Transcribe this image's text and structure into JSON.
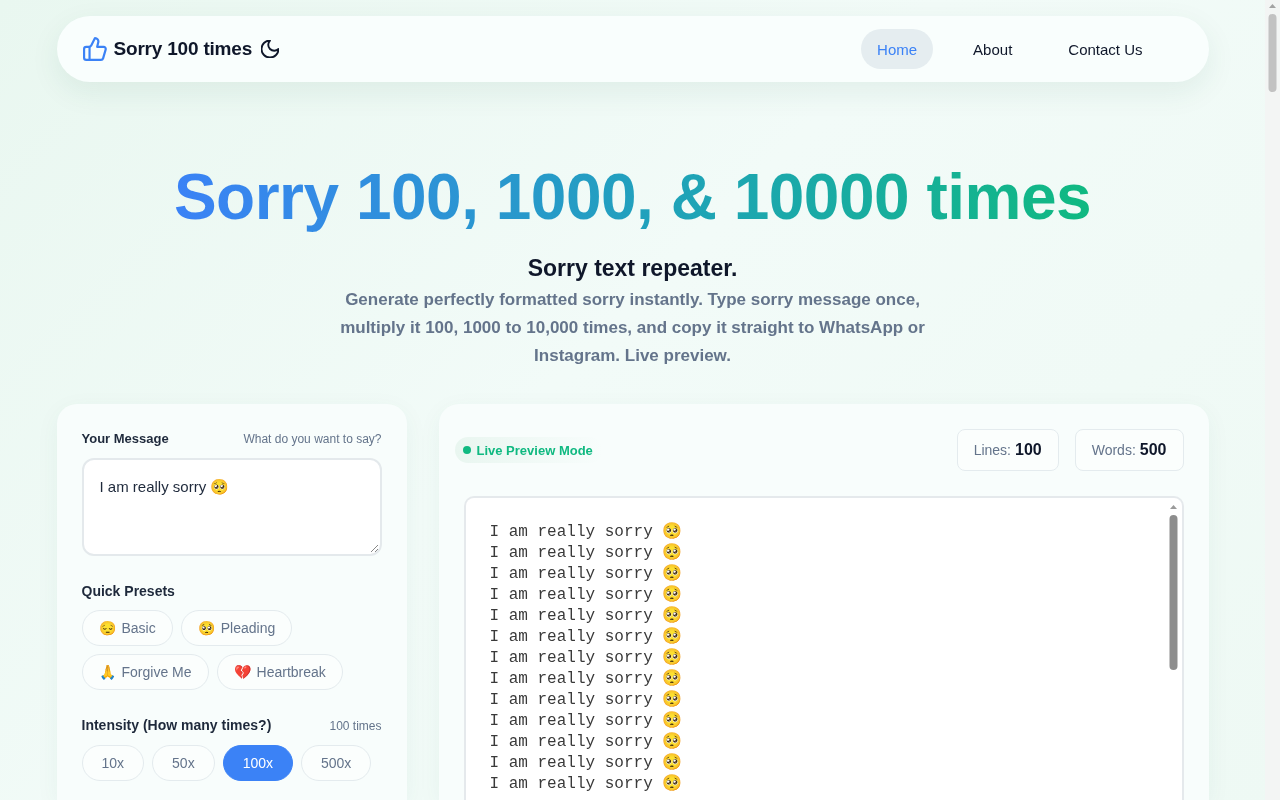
{
  "navbar": {
    "brand": "Sorry 100 times",
    "links": [
      {
        "label": "Home",
        "selected": true
      },
      {
        "label": "About",
        "selected": false
      },
      {
        "label": "Contact Us",
        "selected": false
      }
    ]
  },
  "hero": {
    "title": "Sorry 100, 1000, & 10000 times",
    "subtitle": "Sorry text repeater.",
    "description": "Generate perfectly formatted sorry instantly. Type sorry message once, multiply it 100, 1000 to 10,000 times, and copy it straight to WhatsApp or Instagram. Live preview."
  },
  "message_panel": {
    "label": "Your Message",
    "helper_text": "What do you want to say?",
    "message": "I am really sorry 🥺",
    "presets_label": "Quick Presets",
    "presets": [
      {
        "emoji": "😔",
        "label": "Basic"
      },
      {
        "emoji": "🥺",
        "label": "Pleading"
      },
      {
        "emoji": "🙏",
        "label": "Forgive Me"
      },
      {
        "emoji": "💔",
        "label": "Heartbreak"
      }
    ],
    "intensity_label": "Intensity (How many times?)",
    "intensity_reading": "100 times",
    "intensity_options": [
      {
        "label": "10x",
        "selected": false
      },
      {
        "label": "50x",
        "selected": false
      },
      {
        "label": "100x",
        "selected": true
      },
      {
        "label": "500x",
        "selected": false
      }
    ]
  },
  "preview_panel": {
    "mode": "Live Preview Mode",
    "stats": [
      {
        "label": "Lines:",
        "value": "100"
      },
      {
        "label": "Words:",
        "value": "500"
      }
    ],
    "lines": [
      "I am really sorry 🥺",
      "I am really sorry 🥺",
      "I am really sorry 🥺",
      "I am really sorry 🥺",
      "I am really sorry 🥺",
      "I am really sorry 🥺",
      "I am really sorry 🥺",
      "I am really sorry 🥺",
      "I am really sorry 🥺",
      "I am really sorry 🥺",
      "I am really sorry 🥺",
      "I am really sorry 🥺",
      "I am really sorry 🥺"
    ]
  }
}
